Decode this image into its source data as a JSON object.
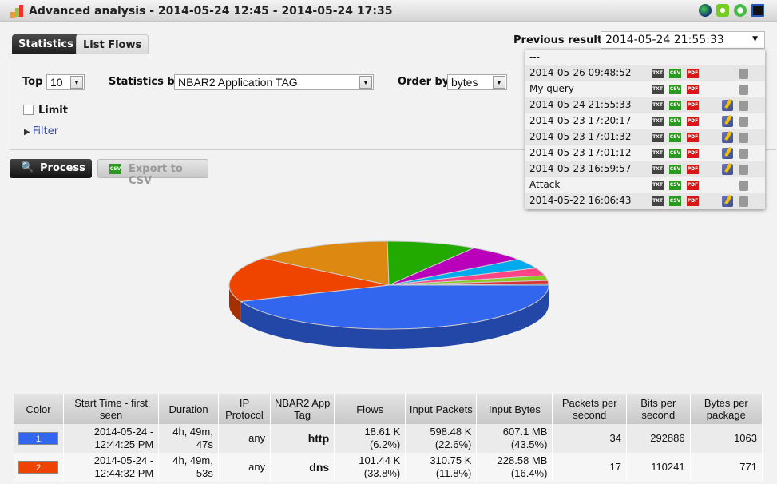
{
  "window": {
    "title": "Advanced analysis - 2014-05-24 12:45 - 2014-05-24 17:35",
    "icons": [
      "globe-icon",
      "green-square-icon",
      "green-gear-icon",
      "terminal-icon"
    ]
  },
  "tabs": [
    {
      "label": "Statistics",
      "active": true
    },
    {
      "label": "List Flows",
      "active": false
    }
  ],
  "form": {
    "top_label": "Top",
    "top_value": "10",
    "stats_label": "Statistics by",
    "stats_value": "NBAR2 Application TAG",
    "order_label": "Order by",
    "order_value": "bytes",
    "limit_label": "Limit",
    "limit_checked": false,
    "filter_label": "Filter"
  },
  "buttons": {
    "process": "Process",
    "export": "Export to CSV"
  },
  "previous": {
    "label": "Previous results",
    "value": "2014-05-24 21:55:33",
    "items": [
      {
        "name": "---",
        "files": false,
        "edit": false
      },
      {
        "name": "2014-05-26 09:48:52",
        "files": true,
        "edit": false
      },
      {
        "name": "My query",
        "files": true,
        "edit": false
      },
      {
        "name": "2014-05-24 21:55:33",
        "files": true,
        "edit": true
      },
      {
        "name": "2014-05-23 17:20:17",
        "files": true,
        "edit": true
      },
      {
        "name": "2014-05-23 17:01:32",
        "files": true,
        "edit": true
      },
      {
        "name": "2014-05-23 17:01:12",
        "files": true,
        "edit": true
      },
      {
        "name": "2014-05-23 16:59:57",
        "files": true,
        "edit": true
      },
      {
        "name": "Attack",
        "files": true,
        "edit": false
      },
      {
        "name": "2014-05-22 16:06:43",
        "files": true,
        "edit": true
      }
    ],
    "file_labels": [
      "TXT",
      "CSV",
      "PDF"
    ]
  },
  "chart_data": {
    "type": "pie",
    "values": [
      43.5,
      16.4,
      14.2,
      9.0,
      6.0,
      3.6,
      2.8,
      1.8,
      1.2,
      0.5
    ],
    "colors": [
      "#3366ee",
      "#ee4400",
      "#dd8811",
      "#22aa00",
      "#bb00bb",
      "#00aaee",
      "#ff4488",
      "#88cc22",
      "#dd3333",
      "#6688aa"
    ]
  },
  "table": {
    "headers": [
      "Color",
      "Start Time - first seen",
      "Duration",
      "IP Protocol",
      "NBAR2 App Tag",
      "Flows",
      "Input Packets",
      "Input Bytes",
      "Packets per second",
      "Bits per second",
      "Bytes per package"
    ],
    "rows": [
      {
        "color": "#3366ee",
        "index": "1",
        "start": "2014-05-24 - 12:44:25 PM",
        "duration": "4h, 49m, 47s",
        "proto": "any",
        "tag": "http",
        "flows": "18.61 K (6.2%)",
        "packets": "598.48 K (22.6%)",
        "bytes": "607.1 MB (43.5%)",
        "pps": "34",
        "bps": "292886",
        "bpp": "1063"
      },
      {
        "color": "#ee4400",
        "index": "2",
        "start": "2014-05-24 - 12:44:32 PM",
        "duration": "4h, 49m, 53s",
        "proto": "any",
        "tag": "dns",
        "flows": "101.44 K (33.8%)",
        "packets": "310.75 K (11.8%)",
        "bytes": "228.58 MB (16.4%)",
        "pps": "17",
        "bps": "110241",
        "bpp": "771"
      }
    ]
  }
}
